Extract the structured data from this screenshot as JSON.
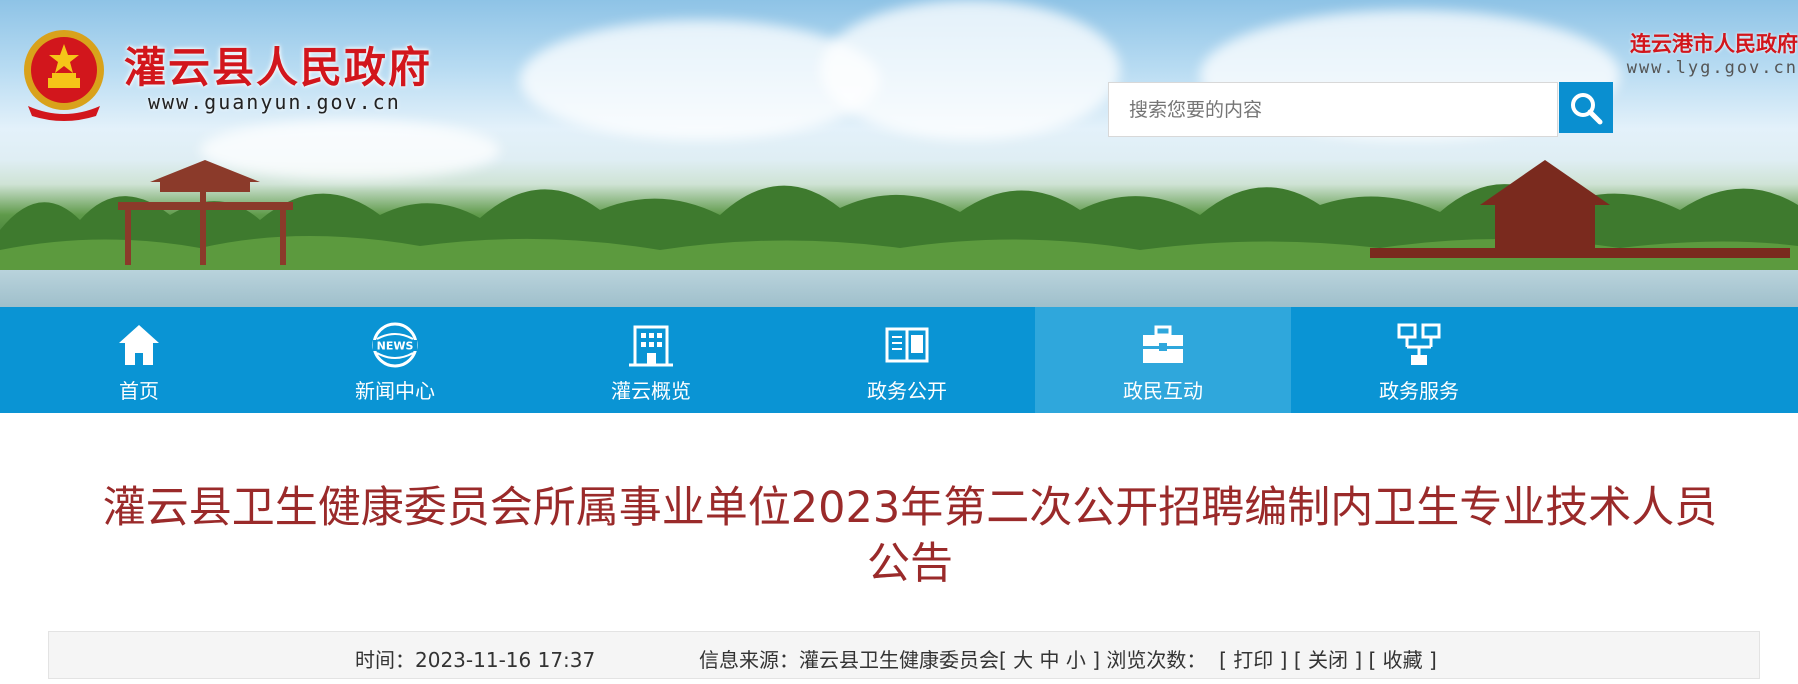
{
  "header": {
    "site_name": "灌云县人民政府",
    "site_url": "www.guanyun.gov.cn",
    "city_link": "连云港市人民政府",
    "city_url": "www.lyg.gov.cn",
    "search_placeholder": "搜索您要的内容"
  },
  "nav": {
    "items": [
      {
        "label": "首页",
        "icon": "home-icon"
      },
      {
        "label": "新闻中心",
        "icon": "news-icon"
      },
      {
        "label": "灌云概览",
        "icon": "building-icon"
      },
      {
        "label": "政务公开",
        "icon": "book-icon"
      },
      {
        "label": "政民互动",
        "icon": "briefcase-icon",
        "active": true
      },
      {
        "label": "政务服务",
        "icon": "network-icon"
      }
    ]
  },
  "article": {
    "title_line1": "灌云县卫生健康委员会所属事业单位2023年第二次公开招聘编制内卫生专业技术人员",
    "title_line2": "公告",
    "time_label": "时间：",
    "time_value": "2023-11-16 17:37",
    "source_label": "信息来源：",
    "source_value": "灌云县卫生健康委员会",
    "font_open": "[",
    "font_large": "大",
    "font_medium": "中",
    "font_small": "小",
    "font_close": "]",
    "views_label": "浏览次数：",
    "print_label": "[ 打印 ]",
    "close_label": "[ 关闭 ]",
    "favorite_label": "[ 收藏 ]"
  },
  "colors": {
    "nav_bg": "#0a94d4",
    "nav_active": "#2fa7dc",
    "title": "#9a2a2a",
    "site_name": "#d2161c"
  }
}
